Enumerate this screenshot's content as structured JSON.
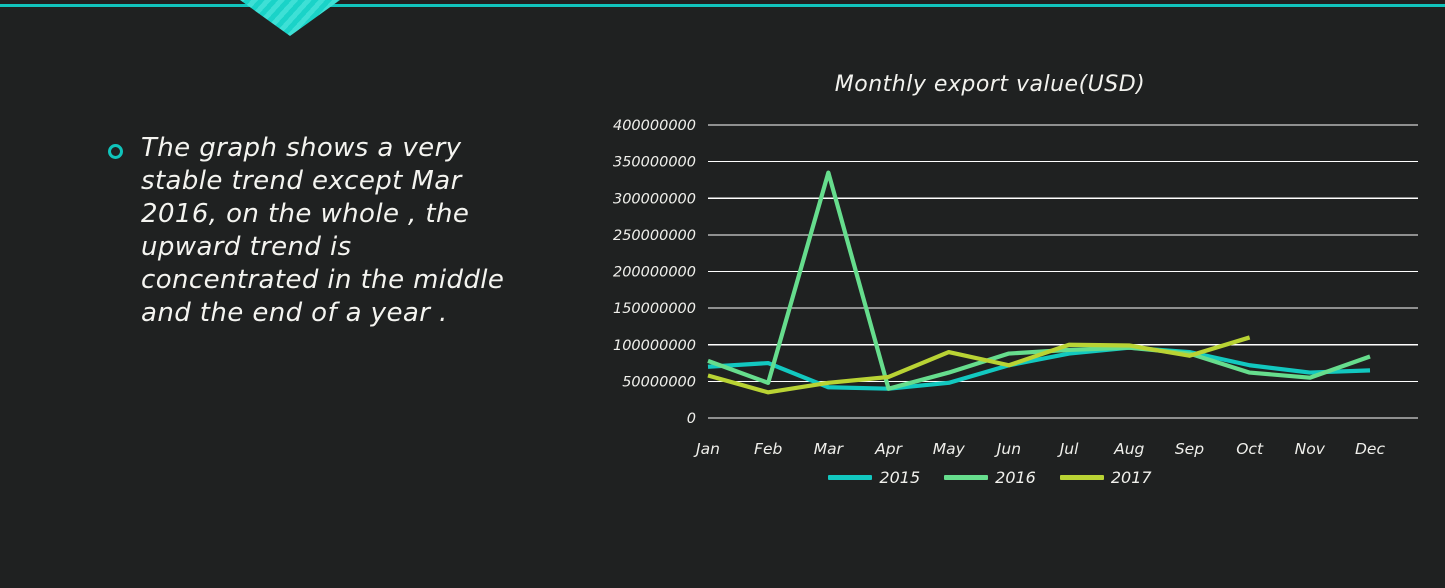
{
  "slide": {
    "background_color": "#1f2121",
    "accent_color": "#11c4bd"
  },
  "decoration": {
    "top_rule_name": "top-accent-rule",
    "chevron_name": "chevron-decoration"
  },
  "bullet": {
    "marker_color": "#10c4bb",
    "text": "The graph shows a very stable trend except Mar 2016, on the whole , the upward trend is concentrated in the middle and the end of a year ."
  },
  "chart_data": {
    "type": "line",
    "title": "Monthly export value(USD)",
    "xlabel": "",
    "ylabel": "",
    "categories": [
      "Jan",
      "Feb",
      "Mar",
      "Apr",
      "May",
      "Jun",
      "Jul",
      "Aug",
      "Sep",
      "Oct",
      "Nov",
      "Dec"
    ],
    "ylim": [
      0,
      400000000
    ],
    "ytick_values": [
      0,
      50000000,
      100000000,
      150000000,
      200000000,
      250000000,
      300000000,
      350000000,
      400000000
    ],
    "ytick_labels": [
      "0",
      "50000000",
      "100000000",
      "150000000",
      "200000000",
      "250000000",
      "300000000",
      "350000000",
      "400000000"
    ],
    "grid": true,
    "legend_position": "bottom",
    "series": [
      {
        "name": "2015",
        "color": "#12c8c0",
        "values": [
          70000000,
          75000000,
          42000000,
          40000000,
          48000000,
          72000000,
          88000000,
          96000000,
          90000000,
          72000000,
          62000000,
          65000000
        ]
      },
      {
        "name": "2016",
        "color": "#66dd8d",
        "values": [
          78000000,
          48000000,
          335000000,
          40000000,
          62000000,
          88000000,
          93000000,
          96000000,
          88000000,
          62000000,
          55000000,
          84000000
        ]
      },
      {
        "name": "2017",
        "color": "#b9d334",
        "values": [
          58000000,
          35000000,
          48000000,
          56000000,
          90000000,
          72000000,
          100000000,
          99000000,
          85000000,
          110000000,
          null,
          null
        ]
      }
    ]
  }
}
